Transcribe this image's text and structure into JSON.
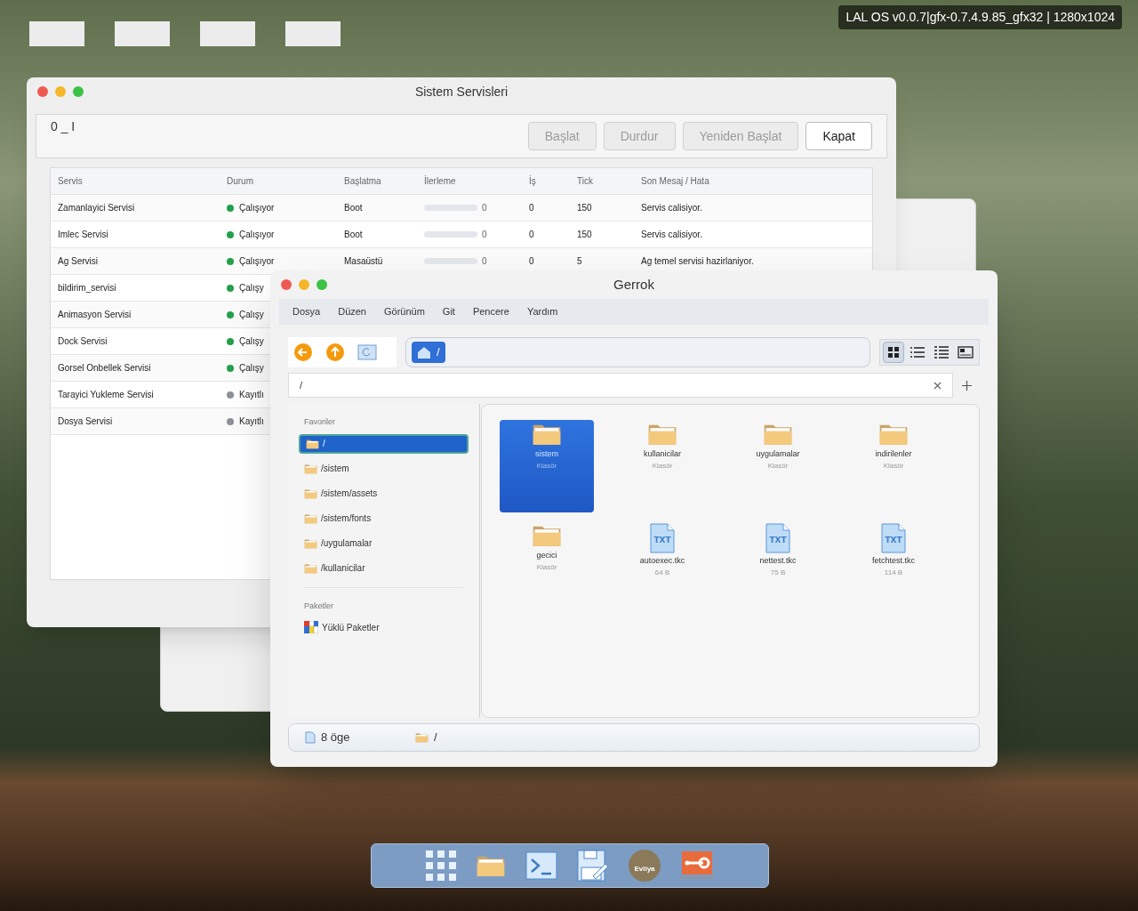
{
  "overlay_label": "LAL OS v0.0.7|gfx-0.7.4.9.85_gfx32 | 1280x1024",
  "services_window": {
    "title": "Sistem Servisleri",
    "counter": "0 _ I",
    "buttons": [
      {
        "label": "Başlat",
        "disabled": true
      },
      {
        "label": "Durdur",
        "disabled": true
      },
      {
        "label": "Yeniden Başlat",
        "disabled": true
      },
      {
        "label": "Kapat",
        "disabled": false
      }
    ],
    "columns": [
      "Servis",
      "Durum",
      "Başlatma",
      "İlerleme",
      "İş",
      "Tick",
      "Son Mesaj / Hata"
    ],
    "rows": [
      {
        "name": "Zamanlayici Servisi",
        "color": "#22a04a",
        "status": "Çalışıyor",
        "start": "Boot",
        "level": 0,
        "progress": "0",
        "jobs": "0",
        "tick": "150",
        "message": "Servis calisiyor."
      },
      {
        "name": "Imlec Servisi",
        "color": "#22a04a",
        "status": "Çalışıyor",
        "start": "Boot",
        "level": 0,
        "progress": "0",
        "jobs": "0",
        "tick": "150",
        "message": "Servis calisiyor."
      },
      {
        "name": "Ag Servisi",
        "color": "#22a04a",
        "status": "Çalışıyor",
        "start": "Masaüstü",
        "level": 0,
        "progress": "0",
        "jobs": "0",
        "tick": "5",
        "message": "Ag temel servisi hazirlaniyor."
      },
      {
        "name": "bildirim_servisi",
        "color": "#22a04a",
        "status": "Çalışy"
      },
      {
        "name": "Animasyon Servisi",
        "color": "#22a04a",
        "status": "Çalışy"
      },
      {
        "name": "Dock Servisi",
        "color": "#22a04a",
        "status": "Çalışy"
      },
      {
        "name": "Gorsel Onbellek Servisi",
        "color": "#22a04a",
        "status": "Çalışy"
      },
      {
        "name": "Tarayici Yukleme Servisi",
        "color": "#8a8f98",
        "status": "Kayıtlı"
      },
      {
        "name": "Dosya Servisi",
        "color": "#8a8f98",
        "status": "Kayıtlı"
      }
    ]
  },
  "file_window": {
    "title": "Gerrok",
    "menu": [
      "Dosya",
      "Düzen",
      "Görünüm",
      "Git",
      "Pencere",
      "Yardım"
    ],
    "breadcrumb": "/",
    "path_field": "/",
    "view_modes": [
      {
        "kind": "grid",
        "selected": true
      },
      {
        "kind": "compact",
        "selected": false
      },
      {
        "kind": "list",
        "selected": false
      },
      {
        "kind": "preview",
        "selected": false
      }
    ],
    "sidebar": [
      {
        "title": "Favoriler",
        "items": [
          {
            "label": "/",
            "kind": "folder",
            "selected": true
          },
          {
            "label": "/sistem",
            "kind": "folder",
            "selected": false
          },
          {
            "label": "/sistem/assets",
            "kind": "folder",
            "selected": false
          },
          {
            "label": "/sistem/fonts",
            "kind": "folder",
            "selected": false
          },
          {
            "label": "/uygulamalar",
            "kind": "folder",
            "selected": false
          },
          {
            "label": "/kullanicilar",
            "kind": "folder",
            "selected": false
          }
        ]
      },
      {
        "title": "Paketler",
        "items": [
          {
            "label": "Yüklü Paketler",
            "kind": "package",
            "selected": false
          }
        ]
      }
    ],
    "items": [
      {
        "name": "sistem",
        "kind": "folder",
        "detail": "Klasör",
        "selected": true
      },
      {
        "name": "kullanicilar",
        "kind": "folder",
        "detail": "Klasör",
        "selected": false
      },
      {
        "name": "uygulamalar",
        "kind": "folder",
        "detail": "Klasör",
        "selected": false
      },
      {
        "name": "indirilenler",
        "kind": "folder",
        "detail": "Klasör",
        "selected": false
      },
      {
        "name": "gecici",
        "kind": "folder",
        "detail": "Klasör",
        "selected": false
      },
      {
        "name": "autoexec.tkc",
        "kind": "text",
        "badge": "TXT",
        "detail": "64 B",
        "selected": false
      },
      {
        "name": "nettest.tkc",
        "kind": "text",
        "badge": "TXT",
        "detail": "75 B",
        "selected": false
      },
      {
        "name": "fetchtest.tkc",
        "kind": "text",
        "badge": "TXT",
        "detail": "114 B",
        "selected": false
      }
    ],
    "status": {
      "count": "8 öge",
      "path": "/"
    }
  },
  "dock": [
    {
      "kind": "apps"
    },
    {
      "kind": "folder"
    },
    {
      "kind": "terminal"
    },
    {
      "kind": "editor"
    },
    {
      "kind": "avatar",
      "label": "Evliya"
    },
    {
      "kind": "tools"
    }
  ]
}
